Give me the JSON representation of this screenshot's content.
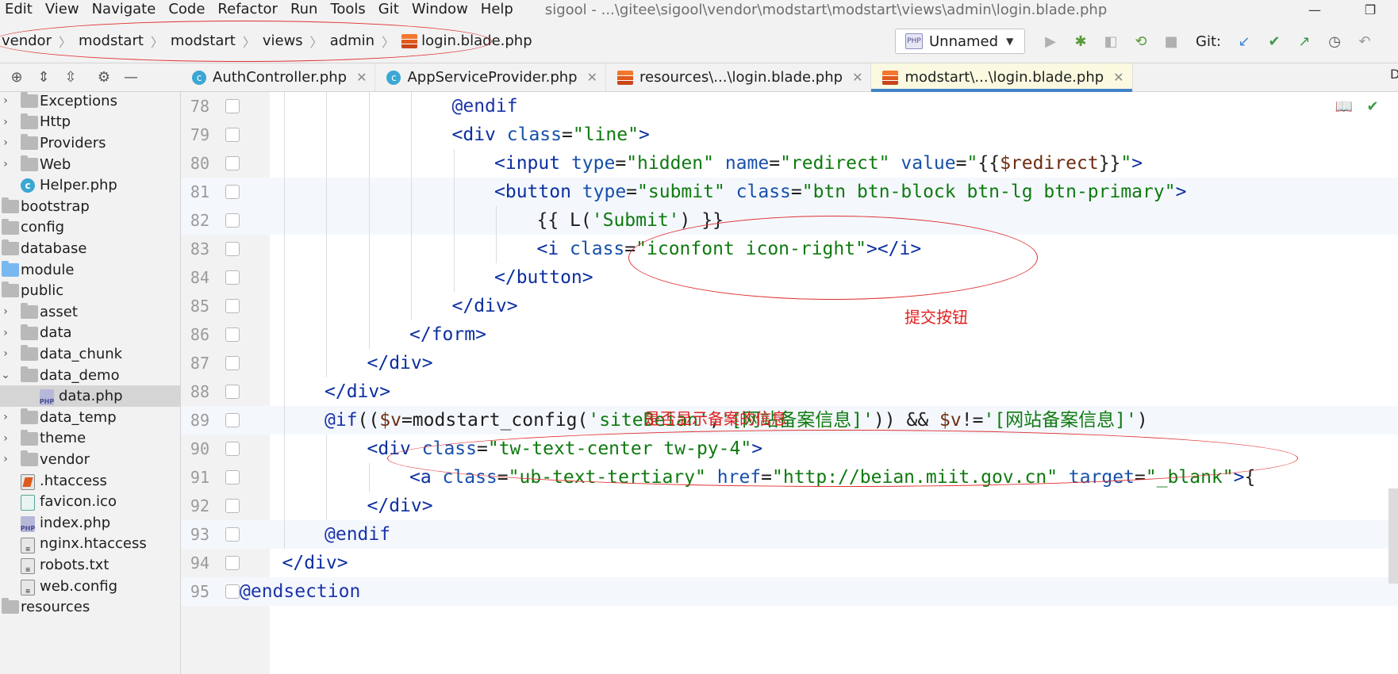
{
  "menu": {
    "items": [
      "Edit",
      "View",
      "Navigate",
      "Code",
      "Refactor",
      "Run",
      "Tools",
      "Git",
      "Window",
      "Help"
    ],
    "window_title": "sigool - ...\\gitee\\sigool\\vendor\\modstart\\modstart\\views\\admin\\login.blade.php"
  },
  "breadcrumb": [
    "vendor",
    "modstart",
    "modstart",
    "views",
    "admin",
    "login.blade.php"
  ],
  "run_config": {
    "label": "Unnamed"
  },
  "toolbar": {
    "git_label": "Git:"
  },
  "project_tree": [
    {
      "label": "Exceptions",
      "type": "folder",
      "depth": 1,
      "arrow": "›"
    },
    {
      "label": "Http",
      "type": "folder",
      "depth": 1,
      "arrow": "›"
    },
    {
      "label": "Providers",
      "type": "folder",
      "depth": 1,
      "arrow": "›"
    },
    {
      "label": "Web",
      "type": "folder",
      "depth": 1,
      "arrow": "›"
    },
    {
      "label": "Helper.php",
      "type": "class",
      "depth": 1
    },
    {
      "label": "bootstrap",
      "type": "folder",
      "depth": 0
    },
    {
      "label": "config",
      "type": "folder",
      "depth": 0
    },
    {
      "label": "database",
      "type": "folder",
      "depth": 0
    },
    {
      "label": "module",
      "type": "folder-blue",
      "depth": 0
    },
    {
      "label": "public",
      "type": "folder",
      "depth": 0
    },
    {
      "label": "asset",
      "type": "folder",
      "depth": 1,
      "arrow": "›"
    },
    {
      "label": "data",
      "type": "folder",
      "depth": 1,
      "arrow": "›"
    },
    {
      "label": "data_chunk",
      "type": "folder",
      "depth": 1,
      "arrow": "›"
    },
    {
      "label": "data_demo",
      "type": "folder",
      "depth": 1,
      "arrow": "⌄"
    },
    {
      "label": "data.php",
      "type": "php",
      "depth": 2,
      "selected": true
    },
    {
      "label": "data_temp",
      "type": "folder",
      "depth": 1,
      "arrow": "›"
    },
    {
      "label": "theme",
      "type": "folder",
      "depth": 1,
      "arrow": "›"
    },
    {
      "label": "vendor",
      "type": "folder",
      "depth": 1,
      "arrow": "›"
    },
    {
      "label": ".htaccess",
      "type": "ht",
      "depth": 1
    },
    {
      "label": "favicon.ico",
      "type": "ico",
      "depth": 1
    },
    {
      "label": "index.php",
      "type": "php",
      "depth": 1
    },
    {
      "label": "nginx.htaccess",
      "type": "text",
      "depth": 1
    },
    {
      "label": "robots.txt",
      "type": "text",
      "depth": 1
    },
    {
      "label": "web.config",
      "type": "text",
      "depth": 1
    },
    {
      "label": "resources",
      "type": "folder",
      "depth": 0
    }
  ],
  "tabs": [
    {
      "label": "AuthController.php",
      "icon": "class"
    },
    {
      "label": "AppServiceProvider.php",
      "icon": "class"
    },
    {
      "label": "resources\\...\\login.blade.php",
      "icon": "blade"
    },
    {
      "label": "modstart\\...\\login.blade.php",
      "icon": "blade",
      "active": true
    }
  ],
  "right_strip_label": "D",
  "code_lines": [
    {
      "n": "78",
      "indent": 5,
      "tokens": [
        [
          "dir",
          "@endif"
        ]
      ]
    },
    {
      "n": "79",
      "indent": 5,
      "tokens": [
        [
          "tag",
          "<div "
        ],
        [
          "attr",
          "class"
        ],
        [
          "plain",
          "="
        ],
        [
          "str",
          "\"line\""
        ],
        [
          "tag",
          ">"
        ]
      ]
    },
    {
      "n": "80",
      "indent": 6,
      "tokens": [
        [
          "tag",
          "<input "
        ],
        [
          "attr",
          "type"
        ],
        [
          "plain",
          "="
        ],
        [
          "str",
          "\"hidden\" "
        ],
        [
          "attr",
          "name"
        ],
        [
          "plain",
          "="
        ],
        [
          "str",
          "\"redirect\" "
        ],
        [
          "attr",
          "value"
        ],
        [
          "plain",
          "="
        ],
        [
          "str",
          "\""
        ],
        [
          "plain",
          "{{"
        ],
        [
          "var",
          "$redirect"
        ],
        [
          "plain",
          "}}"
        ],
        [
          "str",
          "\""
        ],
        [
          "tag",
          ">"
        ]
      ]
    },
    {
      "n": "81",
      "indent": 6,
      "tokens": [
        [
          "tag",
          "<button "
        ],
        [
          "attr",
          "type"
        ],
        [
          "plain",
          "="
        ],
        [
          "str",
          "\"submit\" "
        ],
        [
          "attr",
          "class"
        ],
        [
          "plain",
          "="
        ],
        [
          "str",
          "\"btn btn-block btn-lg btn-primary\""
        ],
        [
          "tag",
          ">"
        ]
      ]
    },
    {
      "n": "82",
      "indent": 7,
      "tokens": [
        [
          "plain",
          "{{ L("
        ],
        [
          "str",
          "'Submit'"
        ],
        [
          "plain",
          ") }}"
        ]
      ]
    },
    {
      "n": "83",
      "indent": 7,
      "tokens": [
        [
          "tag",
          "<i "
        ],
        [
          "attr",
          "class"
        ],
        [
          "plain",
          "="
        ],
        [
          "str",
          "\"iconfont icon-right\""
        ],
        [
          "tag",
          "></i>"
        ]
      ]
    },
    {
      "n": "84",
      "indent": 6,
      "tokens": [
        [
          "tag",
          "</button>"
        ]
      ]
    },
    {
      "n": "85",
      "indent": 5,
      "tokens": [
        [
          "tag",
          "</div>"
        ]
      ]
    },
    {
      "n": "86",
      "indent": 4,
      "tokens": [
        [
          "tag",
          "</form>"
        ]
      ]
    },
    {
      "n": "87",
      "indent": 3,
      "tokens": [
        [
          "tag",
          "</div>"
        ]
      ]
    },
    {
      "n": "88",
      "indent": 2,
      "tokens": [
        [
          "tag",
          "</div>"
        ]
      ]
    },
    {
      "n": "89",
      "indent": 2,
      "tokens": [
        [
          "dir",
          "@if"
        ],
        [
          "plain",
          "(("
        ],
        [
          "var",
          "$v"
        ],
        [
          "plain",
          "=modstart_config("
        ],
        [
          "str",
          "'siteBeian'"
        ],
        [
          "plain",
          ","
        ],
        [
          "str",
          "'[网站备案信息]'"
        ],
        [
          "plain",
          ")) && "
        ],
        [
          "var",
          "$v"
        ],
        [
          "plain",
          "!="
        ],
        [
          "str",
          "'[网站备案信息]'"
        ],
        [
          "plain",
          ")"
        ]
      ]
    },
    {
      "n": "90",
      "indent": 3,
      "tokens": [
        [
          "tag",
          "<div "
        ],
        [
          "attr",
          "class"
        ],
        [
          "plain",
          "="
        ],
        [
          "str",
          "\"tw-text-center tw-py-4\""
        ],
        [
          "tag",
          ">"
        ]
      ]
    },
    {
      "n": "91",
      "indent": 4,
      "tokens": [
        [
          "tag",
          "<a "
        ],
        [
          "attr",
          "class"
        ],
        [
          "plain",
          "="
        ],
        [
          "str",
          "\"ub-text-tertiary\" "
        ],
        [
          "attr",
          "href"
        ],
        [
          "plain",
          "="
        ],
        [
          "str",
          "\"http://beian.miit.gov.cn\" "
        ],
        [
          "attr",
          "target"
        ],
        [
          "plain",
          "="
        ],
        [
          "str",
          "\"_blank\""
        ],
        [
          "tag",
          ">"
        ],
        [
          "plain",
          "{"
        ]
      ]
    },
    {
      "n": "92",
      "indent": 3,
      "tokens": [
        [
          "tag",
          "</div>"
        ]
      ]
    },
    {
      "n": "93",
      "indent": 2,
      "tokens": [
        [
          "dir",
          "@endif"
        ]
      ]
    },
    {
      "n": "94",
      "indent": 1,
      "tokens": [
        [
          "tag",
          "</div>"
        ]
      ]
    },
    {
      "n": "95",
      "indent": 0,
      "tokens": [
        [
          "dir",
          "@endsection"
        ]
      ]
    }
  ],
  "annotations": {
    "submit_note": "提交按钮",
    "beian_note": "是否显示备案的信息"
  }
}
